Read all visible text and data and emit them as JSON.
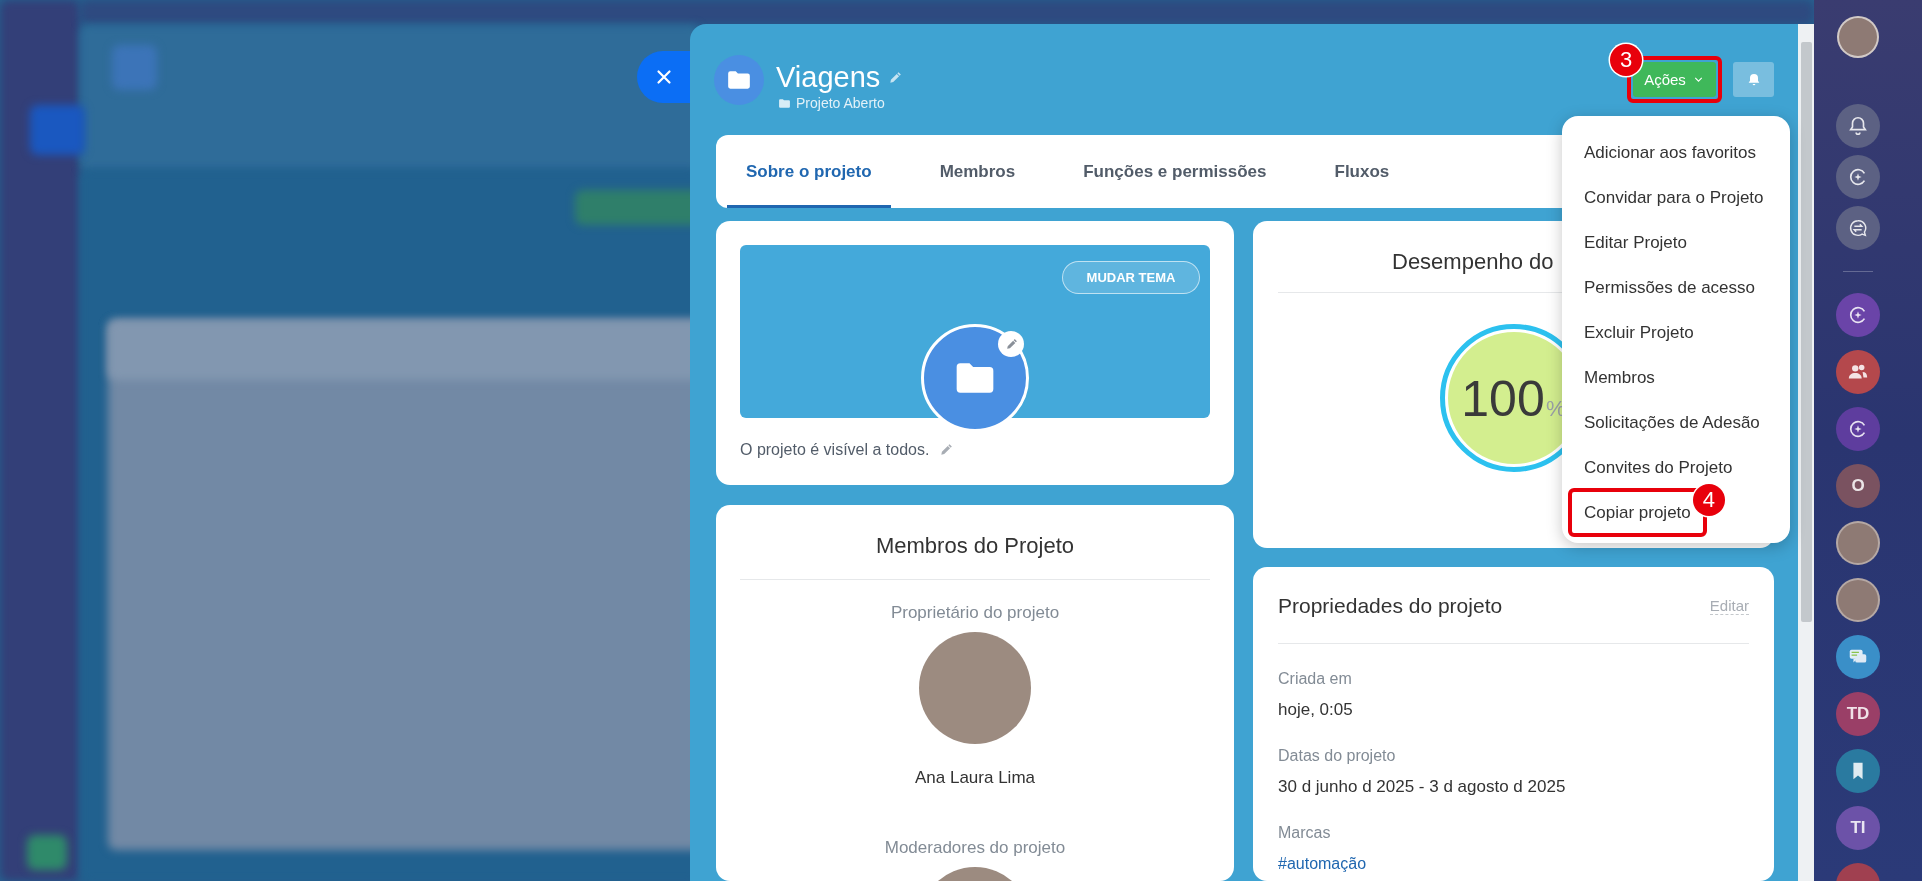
{
  "project": {
    "title": "Viagens",
    "subtitle": "Projeto Aberto"
  },
  "header": {
    "actions_button": {
      "label": "Ações",
      "highlighted": true,
      "step": "3"
    }
  },
  "tabs": [
    {
      "label": "Sobre o projeto",
      "selected": true
    },
    {
      "label": "Membros",
      "selected": false
    },
    {
      "label": "Funções e permissões",
      "selected": false
    },
    {
      "label": "Fluxos",
      "selected": false
    }
  ],
  "cover_card": {
    "theme_button": "MUDAR TEMA",
    "visibility": "O projeto é visível a todos."
  },
  "members_card": {
    "title": "Membros do Projeto",
    "sections": [
      {
        "label": "Proprietário do projeto",
        "members": [
          {
            "kind": "photo",
            "name": "Ana Laura Lima"
          }
        ]
      },
      {
        "label": "Moderadores do projeto",
        "members": [
          {
            "kind": "photo"
          }
        ]
      }
    ]
  },
  "performance_card": {
    "title": "Desempenho do",
    "value": "100",
    "unit": "%",
    "level": 1
  },
  "properties_card": {
    "title": "Propriedades do projeto",
    "edit_link": "Editar",
    "fields": [
      {
        "label": "Criada em",
        "kind": "text",
        "value": "hoje, 0:05"
      },
      {
        "label": "Datas do projeto",
        "kind": "text",
        "value": "30 d junho d 2025 - 3 d agosto d 2025"
      },
      {
        "label": "Marcas",
        "kind": "tag",
        "value": "#automação"
      }
    ]
  },
  "actions_menu": {
    "items": [
      {
        "label": "Adicionar aos favoritos",
        "highlighted": false
      },
      {
        "label": "Convidar para o Projeto",
        "highlighted": false
      },
      {
        "label": "Editar Projeto",
        "highlighted": false
      },
      {
        "label": "Permissões de acesso",
        "highlighted": false
      },
      {
        "label": "Excluir Projeto",
        "highlighted": false
      },
      {
        "label": "Membros",
        "highlighted": false
      },
      {
        "label": "Solicitações de Adesão",
        "highlighted": false
      },
      {
        "label": "Convites do Projeto",
        "highlighted": false
      },
      {
        "label": "Copiar projeto",
        "highlighted": true,
        "step": "4"
      }
    ]
  },
  "right_sidebar": {
    "items": [
      {
        "kind": "avatar"
      },
      {
        "kind": "bell",
        "color": "#5c6183"
      },
      {
        "kind": "ring",
        "color": "#5c6183"
      },
      {
        "kind": "chatswap",
        "color": "#5c6183"
      },
      {
        "kind": "divider"
      },
      {
        "kind": "ring",
        "color": "#6a44a8"
      },
      {
        "kind": "group",
        "color": "#b4484c"
      },
      {
        "kind": "ring",
        "color": "#5e3d9e"
      },
      {
        "kind": "initials",
        "text": "O",
        "color": "#7a5260"
      },
      {
        "kind": "avatar"
      },
      {
        "kind": "avatar"
      },
      {
        "kind": "chat",
        "color": "#3a8fc8"
      },
      {
        "kind": "initials",
        "text": "TD",
        "color": "#9a3f67"
      },
      {
        "kind": "bookmark",
        "color": "#2a7aa0"
      },
      {
        "kind": "initials",
        "text": "TI",
        "color": "#6c52a8"
      },
      {
        "kind": "blank",
        "color": "#a04050"
      }
    ]
  }
}
